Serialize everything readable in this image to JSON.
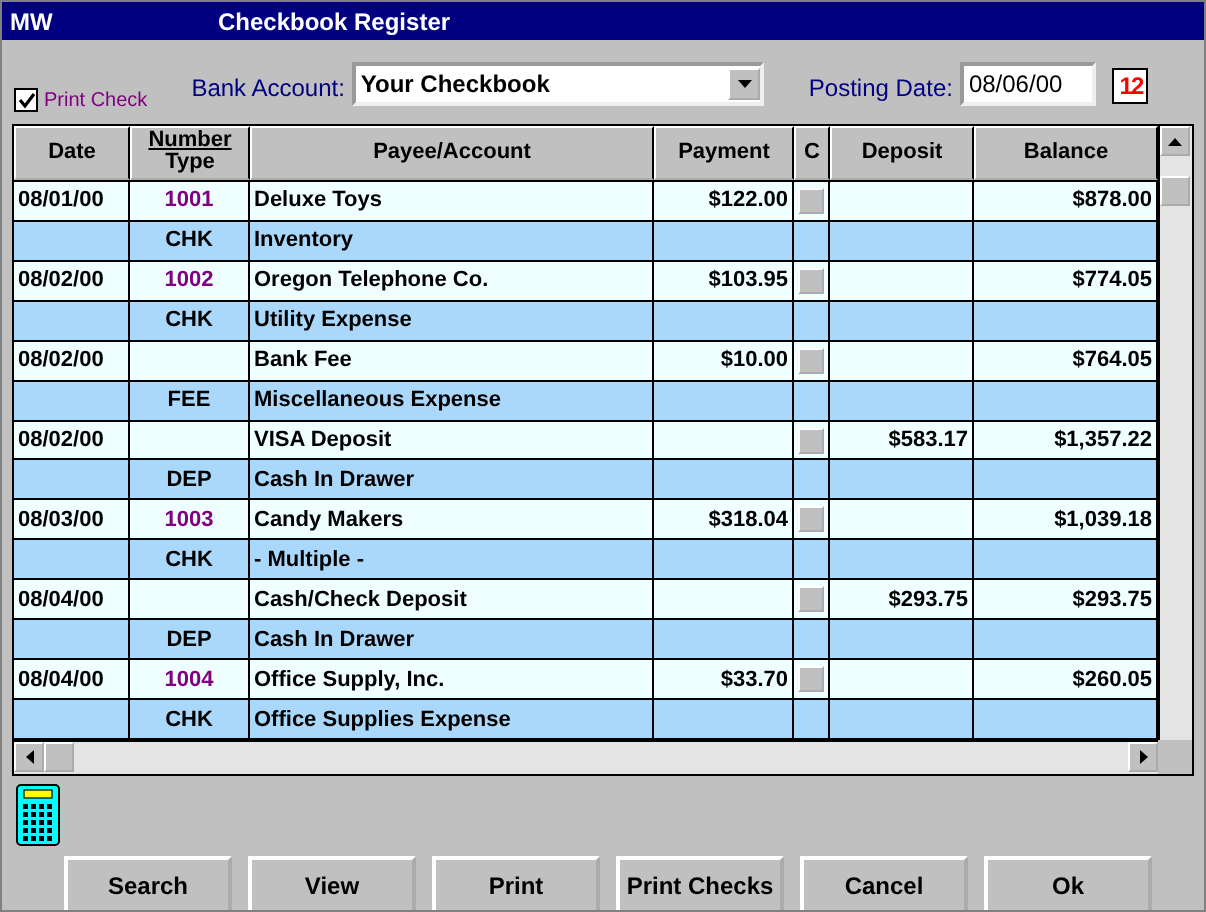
{
  "window": {
    "app_label": "MW",
    "title": "Checkbook Register"
  },
  "print_check": {
    "label": "Print Check",
    "checked": true
  },
  "bank_account": {
    "label": "Bank Account:",
    "value": "Your Checkbook"
  },
  "posting_date": {
    "label": "Posting Date:",
    "value": "08/06/00"
  },
  "calendar_button": {
    "text": "12"
  },
  "table": {
    "columns": [
      "Date",
      "Number",
      "Type",
      "Payee/Account",
      "Payment",
      "C",
      "Deposit",
      "Balance"
    ],
    "rows": [
      {
        "date": "08/01/00",
        "number": "1001",
        "payee": "Deluxe Toys",
        "payment": "$122.00",
        "cleared": false,
        "deposit": "",
        "balance": "$878.00",
        "type": "CHK",
        "account": "Inventory"
      },
      {
        "date": "08/02/00",
        "number": "1002",
        "payee": "Oregon Telephone Co.",
        "payment": "$103.95",
        "cleared": false,
        "deposit": "",
        "balance": "$774.05",
        "type": "CHK",
        "account": "Utility Expense"
      },
      {
        "date": "08/02/00",
        "number": "",
        "payee": "Bank Fee",
        "payment": "$10.00",
        "cleared": false,
        "deposit": "",
        "balance": "$764.05",
        "type": "FEE",
        "account": "Miscellaneous Expense"
      },
      {
        "date": "08/02/00",
        "number": "",
        "payee": "VISA Deposit",
        "payment": "",
        "cleared": false,
        "deposit": "$583.17",
        "balance": "$1,357.22",
        "type": "DEP",
        "account": "Cash In Drawer"
      },
      {
        "date": "08/03/00",
        "number": "1003",
        "payee": "Candy Makers",
        "payment": "$318.04",
        "cleared": false,
        "deposit": "",
        "balance": "$1,039.18",
        "type": "CHK",
        "account": "- Multiple -"
      },
      {
        "date": "08/04/00",
        "number": "",
        "payee": "Cash/Check Deposit",
        "payment": "",
        "cleared": false,
        "deposit": "$293.75",
        "balance": "$293.75",
        "type": "DEP",
        "account": "Cash In Drawer"
      },
      {
        "date": "08/04/00",
        "number": "1004",
        "payee": "Office Supply, Inc.",
        "payment": "$33.70",
        "cleared": false,
        "deposit": "",
        "balance": "$260.05",
        "type": "CHK",
        "account": "Office Supplies Expense"
      }
    ]
  },
  "buttons": [
    "Search",
    "View",
    "Print",
    "Print Checks",
    "Cancel",
    "Ok"
  ]
}
